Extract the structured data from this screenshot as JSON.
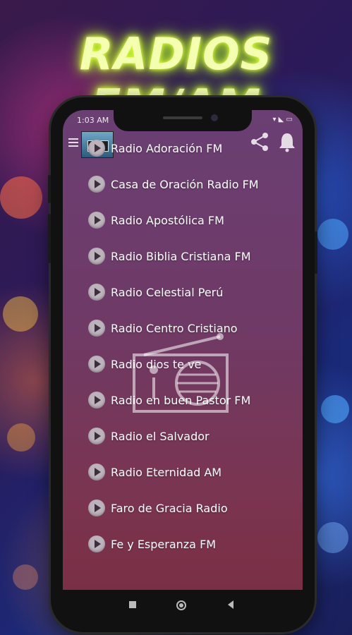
{
  "headline": "RADIOS FM/AM",
  "status_bar": {
    "time": "1:03 AM",
    "right": "▾ ◣ ▭"
  },
  "stations": [
    {
      "label": "Radio Adoración FM"
    },
    {
      "label": "Casa de Oración Radio FM"
    },
    {
      "label": "Radio Apostólica FM"
    },
    {
      "label": "Radio Biblia Cristiana FM"
    },
    {
      "label": "Radio Celestial Perú"
    },
    {
      "label": "Radio Centro Cristiano"
    },
    {
      "label": "Radio dios te ve"
    },
    {
      "label": "Radio en buen Pastor FM"
    },
    {
      "label": "Radio el Salvador"
    },
    {
      "label": "Radio Eternidad AM"
    },
    {
      "label": "Faro de Gracia Radio"
    },
    {
      "label": "Fe y Esperanza FM"
    }
  ],
  "icons": {
    "menu": "menu-icon",
    "share": "share-icon",
    "notification": "bell-icon",
    "play": "play-icon",
    "radio": "radio-icon",
    "nav_back": "back-icon",
    "nav_home": "home-icon",
    "nav_recent": "recent-apps-icon"
  },
  "colors": {
    "headline_glow": "#c8ff2a",
    "list_top": "#6a3f73",
    "list_bottom": "#7a2f45"
  }
}
